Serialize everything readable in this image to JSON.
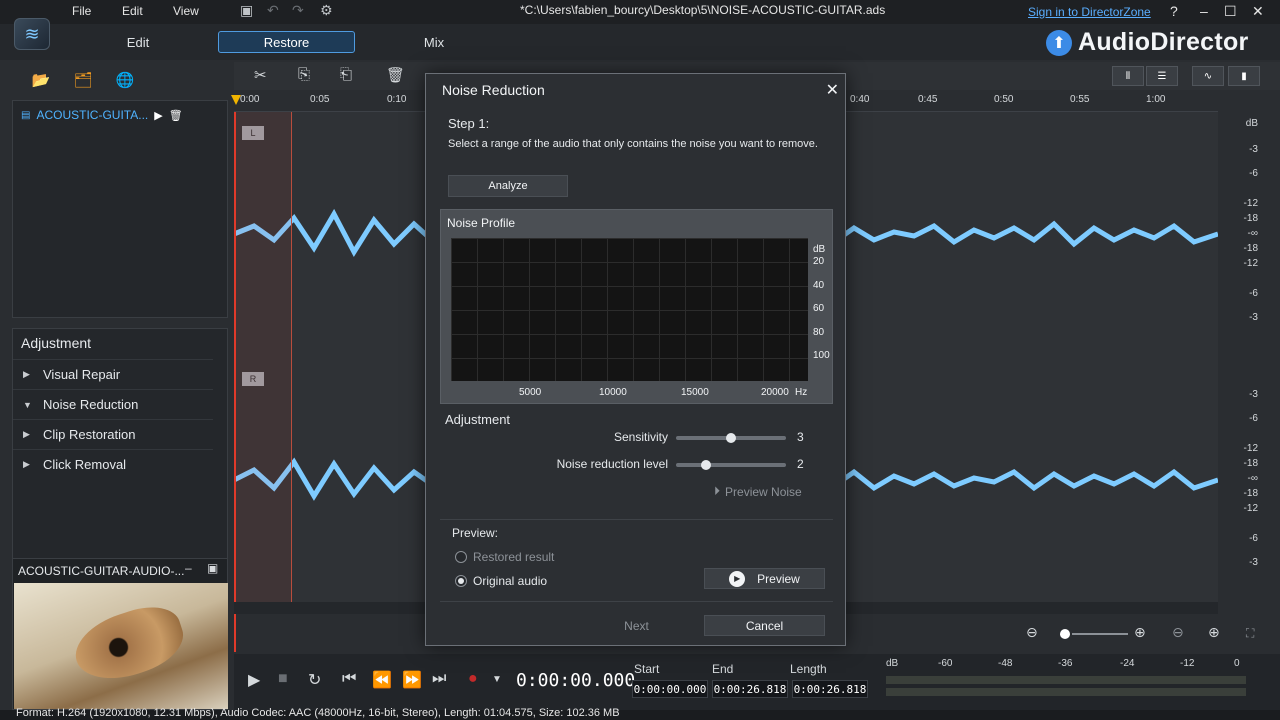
{
  "titlebar": {
    "menus": [
      "File",
      "Edit",
      "View"
    ],
    "file_path": "*C:\\Users\\fabien_bourcy\\Desktop\\5\\NOISE-ACOUSTIC-GUITAR.ads",
    "sign_in": "Sign in to DirectorZone",
    "help": "?",
    "minimize": "–",
    "maximize": "☐",
    "close": "✕"
  },
  "modes": {
    "edit": "Edit",
    "restore": "Restore",
    "mix": "Mix"
  },
  "brand": {
    "name": "AudioDirector",
    "accent": "#3c8be6"
  },
  "library": {
    "item_label": "ACOUSTIC-GUITA..."
  },
  "adjustment": {
    "title": "Adjustment",
    "items": [
      {
        "label": "Visual Repair",
        "arrow": "▶"
      },
      {
        "label": "Noise Reduction",
        "arrow": "▼"
      },
      {
        "label": "Clip Restoration",
        "arrow": "▶"
      },
      {
        "label": "Click Removal",
        "arrow": "▶"
      }
    ]
  },
  "preview_panel": {
    "title": "ACOUSTIC-GUITAR-AUDIO-..."
  },
  "ruler": {
    "ticks": [
      "0:00",
      "0:05",
      "0:10",
      "0:40",
      "0:45",
      "0:50",
      "0:55",
      "1:00"
    ]
  },
  "tracks": {
    "left_label": "L",
    "right_label": "R",
    "db_unit": "dB"
  },
  "db_scale_top": [
    "-3",
    "-6",
    "-12",
    "-18",
    "-∞",
    "-18",
    "-12",
    "-6",
    "-3"
  ],
  "db_scale_bottom": [
    "-3",
    "-6",
    "-12",
    "-18",
    "-∞",
    "-18",
    "-12",
    "-6",
    "-3"
  ],
  "transport": {
    "time": "0:00:00.000",
    "start_label": "Start",
    "end_label": "End",
    "length_label": "Length",
    "start": "0:00:00.000",
    "end": "0:00:26.818",
    "length": "0:00:26.818"
  },
  "meter": {
    "labels": [
      "dB",
      "-60",
      "-48",
      "-36",
      "-24",
      "-12",
      "0"
    ]
  },
  "status": {
    "text": "Format: H.264 (1920x1080, 12.31 Mbps), Audio Codec: AAC (48000Hz, 16-bit, Stereo), Length: 01:04.575, Size: 102.36 MB"
  },
  "dialog": {
    "title": "Noise Reduction",
    "close": "✕",
    "step": "Step 1:",
    "instruction": "Select a range of the audio that only contains the noise you want to remove.",
    "analyze": "Analyze",
    "profile_title": "Noise Profile",
    "y_unit": "dB",
    "y_ticks": [
      "20",
      "40",
      "60",
      "80",
      "100"
    ],
    "x_ticks": [
      "5000",
      "10000",
      "15000",
      "20000"
    ],
    "x_unit": "Hz",
    "adjustment_title": "Adjustment",
    "sensitivity_label": "Sensitivity",
    "sensitivity_value": "3",
    "sensitivity_level": 0.5,
    "noise_level_label": "Noise reduction level",
    "noise_level_value": "2",
    "noise_level_level": 0.25,
    "preview_noise": "Preview Noise",
    "preview_header": "Preview:",
    "restored_result": "Restored result",
    "original_audio": "Original audio",
    "preview_button": "Preview",
    "next": "Next",
    "cancel": "Cancel"
  }
}
